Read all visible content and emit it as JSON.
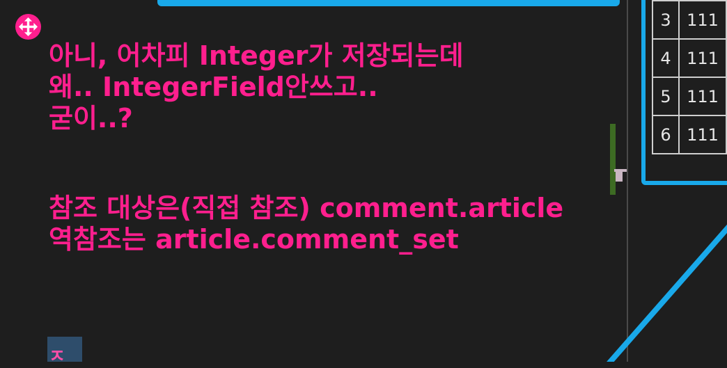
{
  "annotation": {
    "lines": [
      "아니, 어차피 Integer가 저장되는데",
      "왜.. IntegerField안쓰고..",
      "굳이..?",
      "참조 대상은(직접 참조) comment.article",
      "역참조는 article.comment_set"
    ]
  },
  "table": {
    "rows": [
      {
        "idx": "3",
        "val": "111"
      },
      {
        "idx": "4",
        "val": "111"
      },
      {
        "idx": "5",
        "val": "111"
      },
      {
        "idx": "6",
        "val": "111"
      }
    ]
  },
  "thumbnail": {
    "glyph": "ㅈ"
  },
  "colors": {
    "background": "#1e1e1e",
    "annotation_pink": "#ff1f8e",
    "highlight_blue": "#19a9ea",
    "minimap_green": "#3d6b23"
  },
  "icons": {
    "move_handle": "move-arrows-icon"
  }
}
